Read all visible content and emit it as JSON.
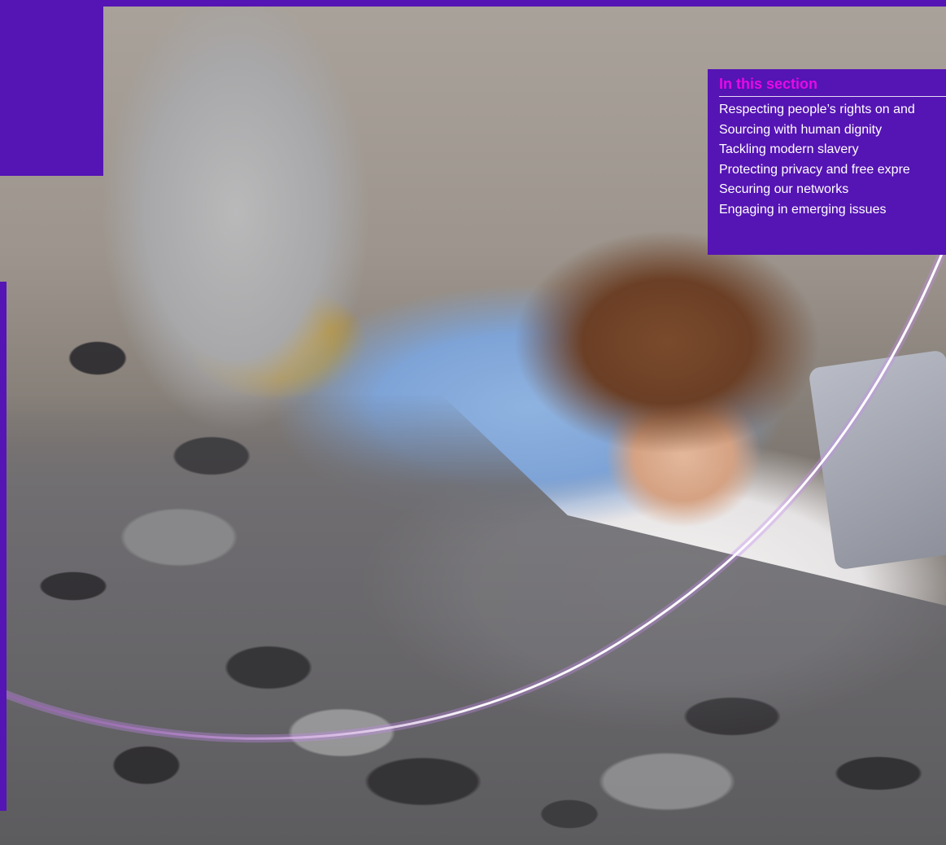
{
  "section_nav": {
    "title": "In this section",
    "items": [
      "Respecting people’s rights on and",
      "Sourcing with human dignity",
      "Tackling modern slavery",
      "Protecting privacy and free expre",
      "Securing our networks",
      "Engaging in emerging issues"
    ]
  },
  "colors": {
    "brand_purple": "#5514b4",
    "accent_magenta": "#e60ae6",
    "text_white": "#ffffff"
  }
}
